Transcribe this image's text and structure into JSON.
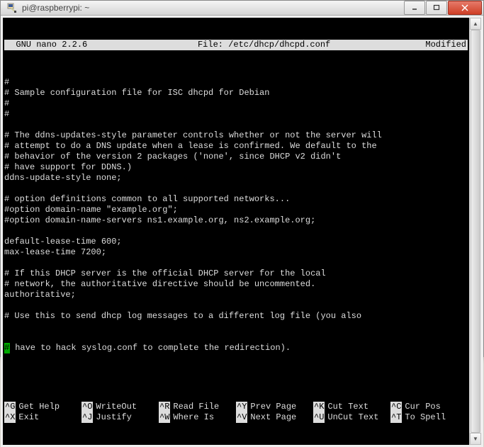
{
  "window": {
    "title": "pi@raspberrypi: ~"
  },
  "editor": {
    "app": "  GNU nano 2.2.6   ",
    "file_label": "File: /etc/dhcp/dhcpd.conf",
    "status": "Modified"
  },
  "file_lines": [
    "#",
    "# Sample configuration file for ISC dhcpd for Debian",
    "#",
    "#",
    "",
    "# The ddns-updates-style parameter controls whether or not the server will",
    "# attempt to do a DNS update when a lease is confirmed. We default to the",
    "# behavior of the version 2 packages ('none', since DHCP v2 didn't",
    "# have support for DDNS.)",
    "ddns-update-style none;",
    "",
    "# option definitions common to all supported networks...",
    "#option domain-name \"example.org\";",
    "#option domain-name-servers ns1.example.org, ns2.example.org;",
    "",
    "default-lease-time 600;",
    "max-lease-time 7200;",
    "",
    "# If this DHCP server is the official DHCP server for the local",
    "# network, the authoritative directive should be uncommented.",
    "authoritative;",
    "",
    "# Use this to send dhcp log messages to a different log file (you also"
  ],
  "cursor_line": {
    "cursor_char": "#",
    "rest": " have to hack syslog.conf to complete the redirection)."
  },
  "shortcuts": [
    {
      "key": "^G",
      "label": "Get Help"
    },
    {
      "key": "^O",
      "label": "WriteOut"
    },
    {
      "key": "^R",
      "label": "Read File"
    },
    {
      "key": "^Y",
      "label": "Prev Page"
    },
    {
      "key": "^K",
      "label": "Cut Text"
    },
    {
      "key": "^C",
      "label": "Cur Pos"
    },
    {
      "key": "^X",
      "label": "Exit"
    },
    {
      "key": "^J",
      "label": "Justify"
    },
    {
      "key": "^W",
      "label": "Where Is"
    },
    {
      "key": "^V",
      "label": "Next Page"
    },
    {
      "key": "^U",
      "label": "UnCut Text"
    },
    {
      "key": "^T",
      "label": "To Spell"
    }
  ]
}
